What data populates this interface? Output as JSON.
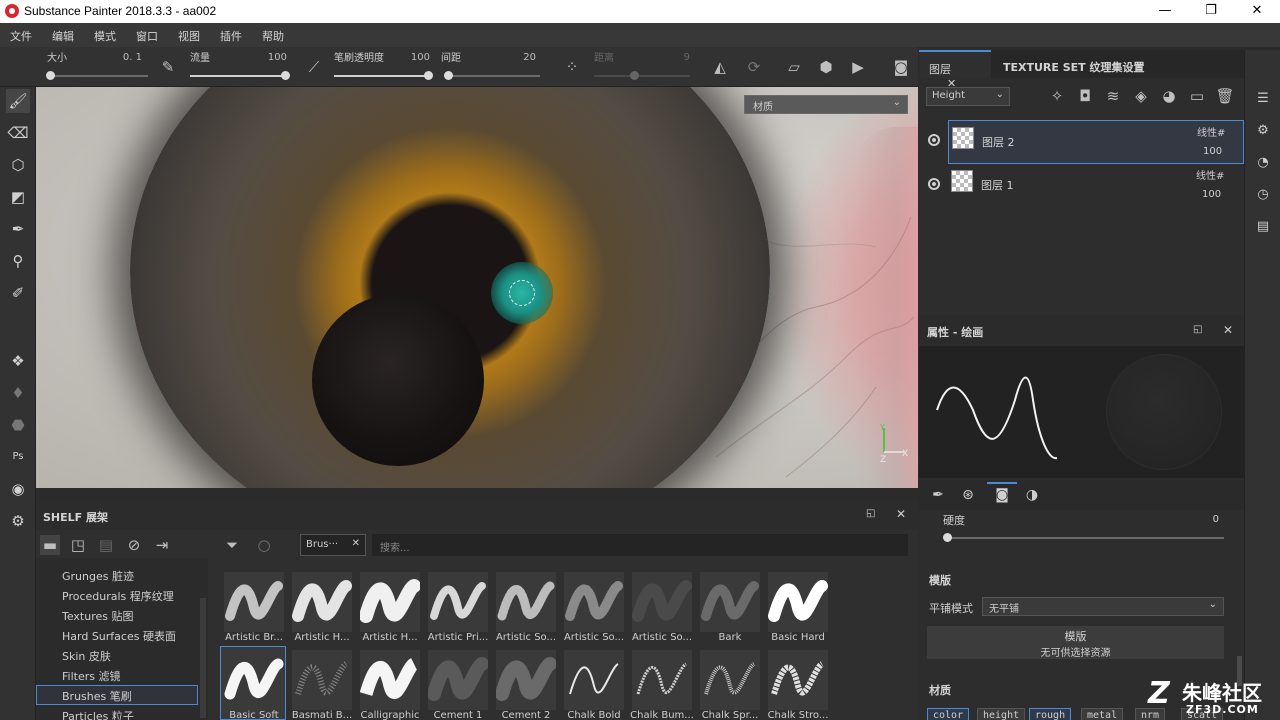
{
  "window": {
    "title": "Substance Painter 2018.3.3 - aa002",
    "minimize_glyph": "—",
    "restore_glyph": "❐",
    "close_glyph": "✕"
  },
  "menu": [
    "文件",
    "编辑",
    "模式",
    "窗口",
    "视图",
    "插件",
    "帮助"
  ],
  "toolbar": {
    "size_label": "大小",
    "size_value": "0. 1",
    "size_fraction": 0.0,
    "flow_label": "流量",
    "flow_value": "100",
    "flow_fraction": 1.0,
    "opacity_label": "笔刷透明度",
    "opacity_value": "100",
    "opacity_fraction": 1.0,
    "spacing_label": "间距",
    "spacing_value": "20",
    "spacing_fraction": 0.0,
    "distance_label": "距离",
    "distance_value": "9"
  },
  "viewport": {
    "material_mode": "材质",
    "gizmo_y": "Y",
    "gizmo_z": "Z",
    "gizmo_x": "X"
  },
  "shelf": {
    "title": "SHELF 展架",
    "filter_tag": "Brus···",
    "search_placeholder": "搜索...",
    "categories": [
      {
        "label": "Grunges 脏迹"
      },
      {
        "label": "Procedurals 程序纹理"
      },
      {
        "label": "Textures 贴图"
      },
      {
        "label": "Hard Surfaces 硬表面"
      },
      {
        "label": "Skin 皮肤"
      },
      {
        "label": "Filters 滤镜"
      },
      {
        "label": "Brushes 笔刷"
      },
      {
        "label": "Particles 粒子"
      }
    ],
    "row1": [
      "Artistic Br...",
      "Artistic H...",
      "Artistic H...",
      "Artistic Pri...",
      "Artistic So...",
      "Artistic So...",
      "Artistic So...",
      "Bark",
      "Basic Hard"
    ],
    "row2": [
      "Basic Soft",
      "Basmati B...",
      "Calligraphic",
      "Cement 1",
      "Cement 2",
      "Chalk Bold",
      "Chalk Bum...",
      "Chalk Spr...",
      "Chalk Stro..."
    ]
  },
  "layers": {
    "tab_layers": "图层",
    "tab_texture_set": "TEXTURE SET 纹理集设置",
    "channel": "Height",
    "items": [
      {
        "name": "图层 2",
        "blend": "线性#",
        "opacity": "100"
      },
      {
        "name": "图层 1",
        "blend": "线性#",
        "opacity": "100"
      }
    ]
  },
  "properties": {
    "title": "属性 - 绘画",
    "hardness_label": "硬度",
    "hardness_value": "0",
    "stencil_section": "模版",
    "tile_mode_label": "平铺模式",
    "tile_mode_value": "无平铺",
    "stencil_box_title": "模版",
    "stencil_box_empty": "无可供选择资源",
    "material_section": "材质",
    "channels": [
      {
        "label": "color",
        "on": true
      },
      {
        "label": "height",
        "on": false
      },
      {
        "label": "rough",
        "on": true
      },
      {
        "label": "metal",
        "on": false
      },
      {
        "label": "nrm",
        "on": false
      },
      {
        "label": "scatt",
        "on": false
      }
    ]
  },
  "watermark": {
    "main": "朱峰社区",
    "sub": "ZF3D.COM"
  },
  "colors": {
    "accent": "#4d8ad6",
    "panel": "#2d2d2d",
    "brush_cursor": "#1b8f82"
  }
}
